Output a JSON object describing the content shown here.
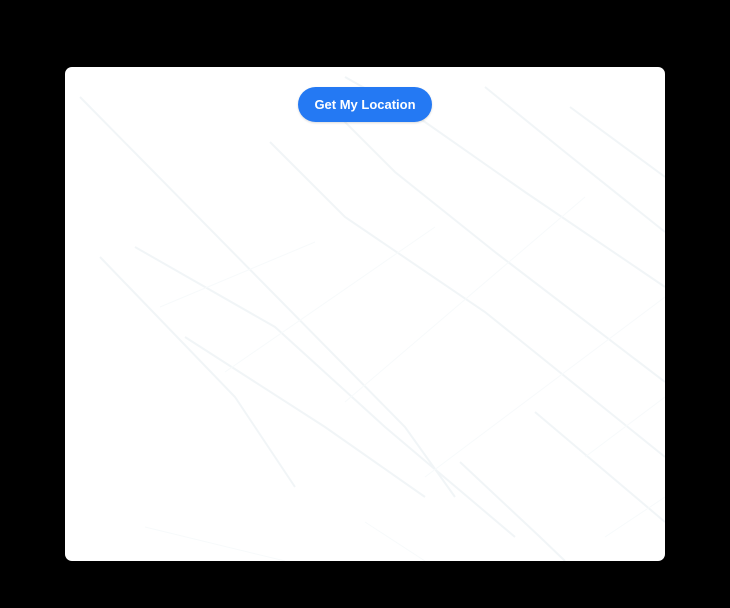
{
  "map_view": {
    "button_label": "Get My Location"
  },
  "colors": {
    "page_background": "#000000",
    "map_background": "#ffffff",
    "road_faint": "#f2f5f7",
    "button_background": "#2479f3",
    "button_text": "#ffffff"
  }
}
